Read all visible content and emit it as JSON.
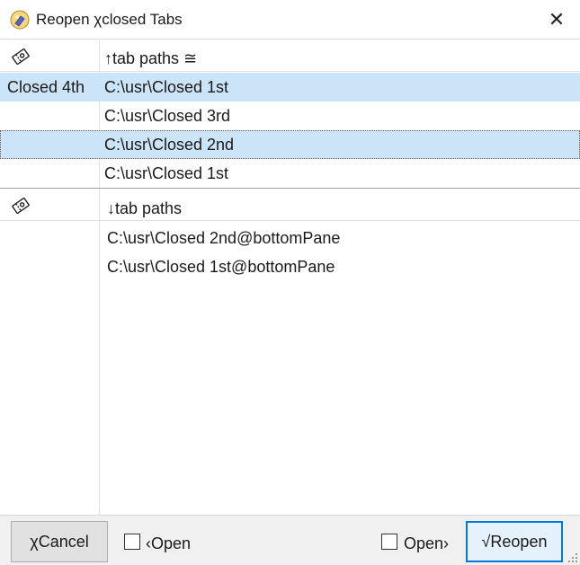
{
  "window": {
    "title": "Reopen χclosed Tabs",
    "close_glyph": "✕"
  },
  "icons": {
    "app": "tab-restore-icon",
    "column": "tab-ticket-icon",
    "close": "close-icon"
  },
  "top_pane": {
    "header": "↑tab paths ≅",
    "rows": [
      {
        "label": "Closed 4th",
        "path": "C:\\usr\\Closed 1st",
        "state": "selected"
      },
      {
        "label": "",
        "path": "C:\\usr\\Closed 3rd",
        "state": "normal"
      },
      {
        "label": "",
        "path": "C:\\usr\\Closed 2nd",
        "state": "focused"
      },
      {
        "label": "",
        "path": "C:\\usr\\Closed 1st",
        "state": "normal"
      }
    ]
  },
  "bottom_pane": {
    "header": "↓tab paths",
    "rows": [
      {
        "path": "C:\\usr\\Closed 2nd@bottomPane"
      },
      {
        "path": "C:\\usr\\Closed 1st@bottomPane"
      }
    ]
  },
  "footer": {
    "cancel_label": "χCancel",
    "open_left_label": "‹Open",
    "open_left_checked": false,
    "open_right_label": "Open›",
    "open_right_checked": false,
    "reopen_label": "√Reopen"
  },
  "colors": {
    "selection": "#cce4f7",
    "accent": "#0078d7",
    "footer_bg": "#f0f0f0"
  }
}
